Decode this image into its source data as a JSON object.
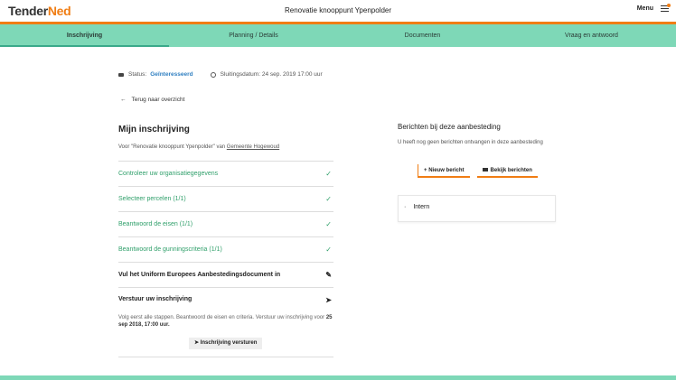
{
  "header": {
    "logo_part1": "Tender",
    "logo_part2": "Ned",
    "title": "Renovatie knooppunt Ypenpolder",
    "menu_label": "Menu"
  },
  "tabs": [
    {
      "label": "Inschrijving",
      "active": true
    },
    {
      "label": "Planning / Details"
    },
    {
      "label": "Documenten"
    },
    {
      "label": "Vraag en antwoord"
    }
  ],
  "meta": {
    "status_label": "Status:",
    "status_value": "Geïnteresseerd",
    "closing": "Sluitingsdatum: 24 sep. 2019 17:00 uur"
  },
  "back_label": "Terug naar overzicht",
  "inschrijving": {
    "title": "Mijn inschrijving",
    "sub_prefix": "Voor \"Renovatie knooppunt Ypenpolder\" van",
    "sub_org": "Gemeente Hogewoud",
    "steps": [
      {
        "label": "Controleer uw organisatiegegevens",
        "mark": "✓"
      },
      {
        "label": "Selecteer percelen (1/1)",
        "mark": "✓"
      },
      {
        "label": "Beantwoord de eisen (1/1)",
        "mark": "✓"
      },
      {
        "label": "Beantwoord de gunningscriteria (1/1)",
        "mark": "✓"
      },
      {
        "label": "Vul het Uniform Europees Aanbestedingsdocument in",
        "mark": "✎"
      }
    ],
    "send": {
      "label": "Verstuur uw inschrijving",
      "mark": "➤",
      "desc": "Volg eerst alle stappen. Beantwoord de eisen en criteria. Verstuur uw inschrijving voor",
      "deadline": "25 sep 2018, 17:00 uur.",
      "button": "Inschrijving versturen",
      "button_icon": "➤"
    }
  },
  "berichten": {
    "title": "Berichten bij deze aanbesteding",
    "none": "U heeft nog geen berichten ontvangen in deze aanbesteding",
    "new_button": "Nieuw bericht",
    "new_icon": "+",
    "view_button": "Bekijk berichten",
    "folder": "Intern"
  },
  "colors": {
    "accent": "#f07d14",
    "tabbar": "#7ed8b7",
    "success": "#2f9f6a",
    "status": "#2f7fc1"
  }
}
